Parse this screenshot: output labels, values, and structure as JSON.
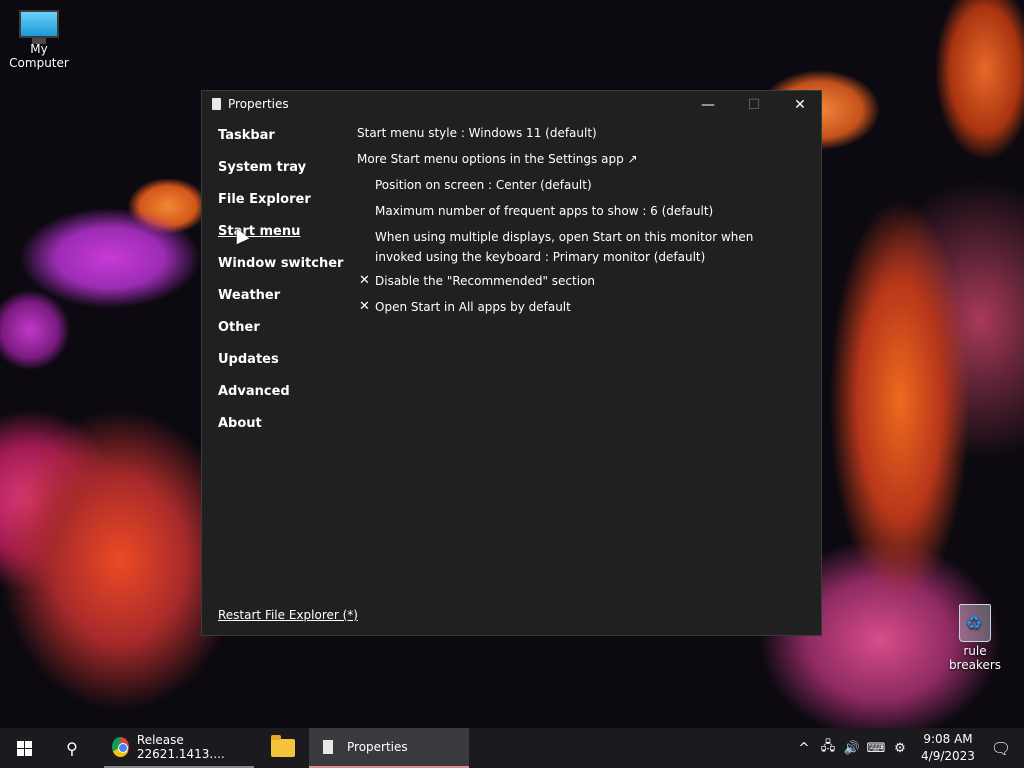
{
  "desktop": {
    "icons": [
      {
        "label": "My Computer"
      },
      {
        "label": "rule breakers"
      }
    ]
  },
  "window": {
    "title": "Properties",
    "controls": {
      "minimize": "—",
      "maximize": "☐",
      "close": "✕"
    },
    "nav": [
      {
        "label": "Taskbar"
      },
      {
        "label": "System tray"
      },
      {
        "label": "File Explorer"
      },
      {
        "label": "Start menu",
        "active": true
      },
      {
        "label": "Window switcher"
      },
      {
        "label": "Weather"
      },
      {
        "label": "Other"
      },
      {
        "label": "Updates"
      },
      {
        "label": "Advanced"
      },
      {
        "label": "About"
      }
    ],
    "settings": {
      "start_menu_style": "Start menu style : Windows 11 (default)",
      "more_options_link": "More Start menu options in the Settings app ↗",
      "position": "Position on screen : Center (default)",
      "max_frequent": "Maximum number of frequent apps to show : 6 (default)",
      "multi_display": "When using multiple displays, open Start on this monitor when invoked using the keyboard : Primary monitor (default)",
      "disable_recommended": {
        "mark": "✕",
        "label": "Disable the \"Recommended\" section"
      },
      "open_all_apps": {
        "mark": "✕",
        "label": "Open Start in All apps by default"
      }
    },
    "footer_link": "Restart File Explorer (*)"
  },
  "taskbar": {
    "chrome_task": "Release 22621.1413....",
    "properties_task": "Properties",
    "tray": {
      "chevron": "^",
      "time": "9:08 AM",
      "date": "4/9/2023"
    }
  },
  "colors": {
    "window_bg": "#202020",
    "taskbar_bg": "#1b1a1f",
    "active_task_bg": "#3a3a3e"
  }
}
